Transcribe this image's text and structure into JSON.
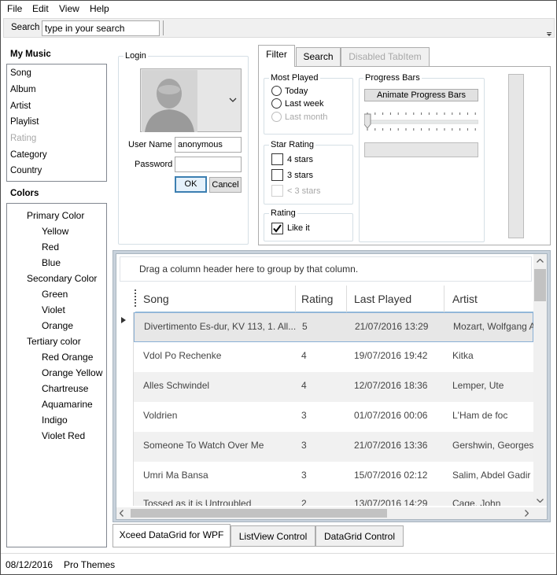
{
  "menu": [
    "File",
    "Edit",
    "View",
    "Help"
  ],
  "toolbar": {
    "search_label": "Search",
    "search_value": "type in your search"
  },
  "left": {
    "my_music_title": "My Music",
    "my_music_items": [
      "Song",
      "Album",
      "Artist",
      "Playlist",
      "Rating",
      "Category",
      "Country"
    ],
    "colors_title": "Colors",
    "colors_tree": [
      {
        "label": "Primary Color",
        "level": 0
      },
      {
        "label": "Yellow",
        "level": 1
      },
      {
        "label": "Red",
        "level": 1
      },
      {
        "label": "Blue",
        "level": 1
      },
      {
        "label": "Secondary Color",
        "level": 0
      },
      {
        "label": "Green",
        "level": 1
      },
      {
        "label": "Violet",
        "level": 1
      },
      {
        "label": "Orange",
        "level": 1
      },
      {
        "label": "Tertiary color",
        "level": 0
      },
      {
        "label": "Red Orange",
        "level": 1
      },
      {
        "label": "Orange Yellow",
        "level": 1
      },
      {
        "label": "Chartreuse",
        "level": 1
      },
      {
        "label": "Aquamarine",
        "level": 1
      },
      {
        "label": "Indigo",
        "level": 1
      },
      {
        "label": "Violet Red",
        "level": 1
      }
    ]
  },
  "login": {
    "title": "Login",
    "username_label": "User Name",
    "username_value": "anonymous",
    "password_label": "Password",
    "password_value": "",
    "ok": "OK",
    "cancel": "Cancel"
  },
  "tabs": [
    {
      "label": "Filter",
      "selected": true,
      "disabled": false
    },
    {
      "label": "Search",
      "selected": false,
      "disabled": false
    },
    {
      "label": "Disabled TabItem",
      "selected": false,
      "disabled": true
    }
  ],
  "filter": {
    "most_played_title": "Most Played",
    "most_played": [
      {
        "label": "Today",
        "disabled": false
      },
      {
        "label": "Last week",
        "disabled": false
      },
      {
        "label": "Last month",
        "disabled": true
      }
    ],
    "star_rating_title": "Star Rating",
    "star_rating": [
      {
        "label": "4 stars",
        "disabled": false,
        "checked": false
      },
      {
        "label": "3 stars",
        "disabled": false,
        "checked": false
      },
      {
        "label": "< 3 stars",
        "disabled": true,
        "checked": false
      }
    ],
    "rating_title": "Rating",
    "like_it": {
      "label": "Like it",
      "checked": true
    },
    "progress_title": "Progress Bars",
    "animate_button": "Animate Progress Bars",
    "slider_value": 0,
    "progress_value": 0
  },
  "grid": {
    "group_hint": "Drag a column header here to group by that column.",
    "columns": [
      "Song",
      "Rating",
      "Last Played",
      "Artist"
    ],
    "rows": [
      {
        "song": "Divertimento Es-dur, KV 113, 1. All...",
        "rating": "5",
        "played": "21/07/2016 13:29",
        "artist": "Mozart, Wolfgang A"
      },
      {
        "song": "Vdol Po Rechenke",
        "rating": "4",
        "played": "19/07/2016 19:42",
        "artist": "Kitka"
      },
      {
        "song": "Alles Schwindel",
        "rating": "4",
        "played": "12/07/2016 18:36",
        "artist": "Lemper, Ute"
      },
      {
        "song": "Voldrien",
        "rating": "3",
        "played": "01/07/2016 00:06",
        "artist": "L'Ham de foc"
      },
      {
        "song": "Someone To Watch Over Me",
        "rating": "3",
        "played": "21/07/2016 13:36",
        "artist": "Gershwin, Georges"
      },
      {
        "song": "Umri Ma Bansa",
        "rating": "3",
        "played": "15/07/2016 02:12",
        "artist": "Salim, Abdel Gadir"
      },
      {
        "song": "Tossed as it is Untroubled",
        "rating": "2",
        "played": "13/07/2016 14:29",
        "artist": "Cage, John"
      }
    ]
  },
  "bottom_tabs": [
    {
      "label": "Xceed DataGrid for WPF",
      "selected": true
    },
    {
      "label": "ListView Control",
      "selected": false
    },
    {
      "label": "DataGrid Control",
      "selected": false
    }
  ],
  "status": {
    "date": "08/12/2016",
    "theme": "Pro Themes"
  }
}
